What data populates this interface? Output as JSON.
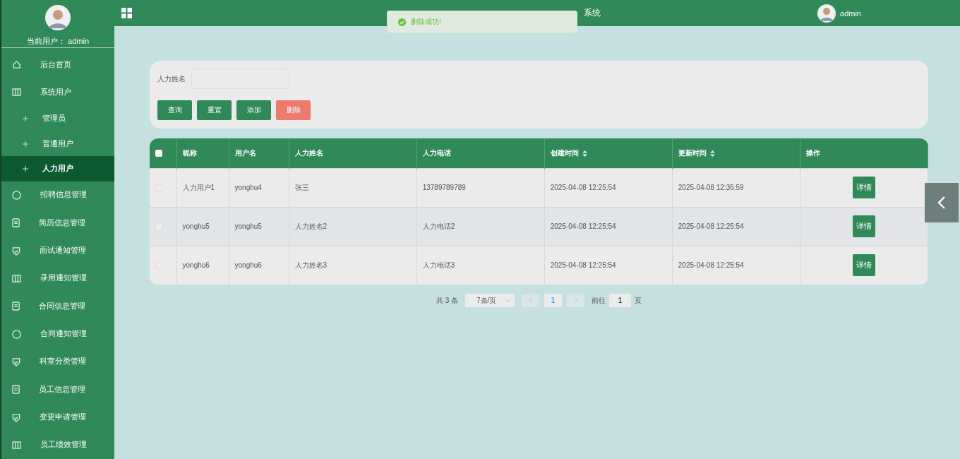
{
  "sidebar": {
    "current_user": "当前用户： admin",
    "items": [
      {
        "label": "后台首页",
        "selected": false
      },
      {
        "label": "系统用户",
        "selected": false,
        "expanded": true,
        "children": [
          {
            "label": "管理员",
            "selected": false
          },
          {
            "label": "普通用户",
            "selected": false
          },
          {
            "label": "人力用户",
            "selected": true
          }
        ]
      },
      {
        "label": "招聘信息管理",
        "selected": false
      },
      {
        "label": "简历信息管理",
        "selected": false
      },
      {
        "label": "面试通知管理",
        "selected": false
      },
      {
        "label": "录用通知管理",
        "selected": false
      },
      {
        "label": "合同信息管理",
        "selected": false
      },
      {
        "label": "合同通知管理",
        "selected": false
      },
      {
        "label": "科室分类管理",
        "selected": false
      },
      {
        "label": "员工信息管理",
        "selected": false
      },
      {
        "label": "变更申请管理",
        "selected": false
      },
      {
        "label": "员工绩效管理",
        "selected": false
      }
    ]
  },
  "header": {
    "title": "系统",
    "user": "admin"
  },
  "toast": {
    "message": "删除成功!"
  },
  "search": {
    "label": "人力姓名",
    "buttons": [
      {
        "label": "查询",
        "kind": "primary"
      },
      {
        "label": "重置",
        "kind": "primary"
      },
      {
        "label": "添加",
        "kind": "primary"
      },
      {
        "label": "删除",
        "kind": "danger"
      }
    ]
  },
  "table": {
    "select_all": {
      "checked": false
    },
    "columns": [
      {
        "label": "昵称",
        "sortable": false
      },
      {
        "label": "用户名",
        "sortable": false
      },
      {
        "label": "人力姓名",
        "sortable": false
      },
      {
        "label": "人力电话",
        "sortable": false
      },
      {
        "label": "创建时间",
        "sortable": true
      },
      {
        "label": "更新时间",
        "sortable": true
      },
      {
        "label": "操作",
        "sortable": false
      }
    ],
    "rows": [
      {
        "checked": false,
        "cells": [
          "人力用户1",
          "yonghu4",
          "张三",
          "13789789789",
          "2025-04-08 12:25:54",
          "2025-04-08 12:35:59"
        ],
        "action": "详情"
      },
      {
        "checked": false,
        "cells": [
          "yonghu5",
          "yonghu5",
          "人力姓名2",
          "人力电话2",
          "2025-04-08 12:25:54",
          "2025-04-08 12:25:54"
        ],
        "action": "详情"
      },
      {
        "checked": false,
        "cells": [
          "yonghu6",
          "yonghu6",
          "人力姓名3",
          "人力电话3",
          "2025-04-08 12:25:54",
          "2025-04-08 12:25:54"
        ],
        "action": "详情"
      }
    ]
  },
  "pagination": {
    "total": "共 3 条",
    "page_size": "7条/页",
    "pages": [
      {
        "label": "1",
        "selected": true
      }
    ],
    "goto_label": "前往",
    "goto_value": "1",
    "goto_suffix": "页"
  }
}
